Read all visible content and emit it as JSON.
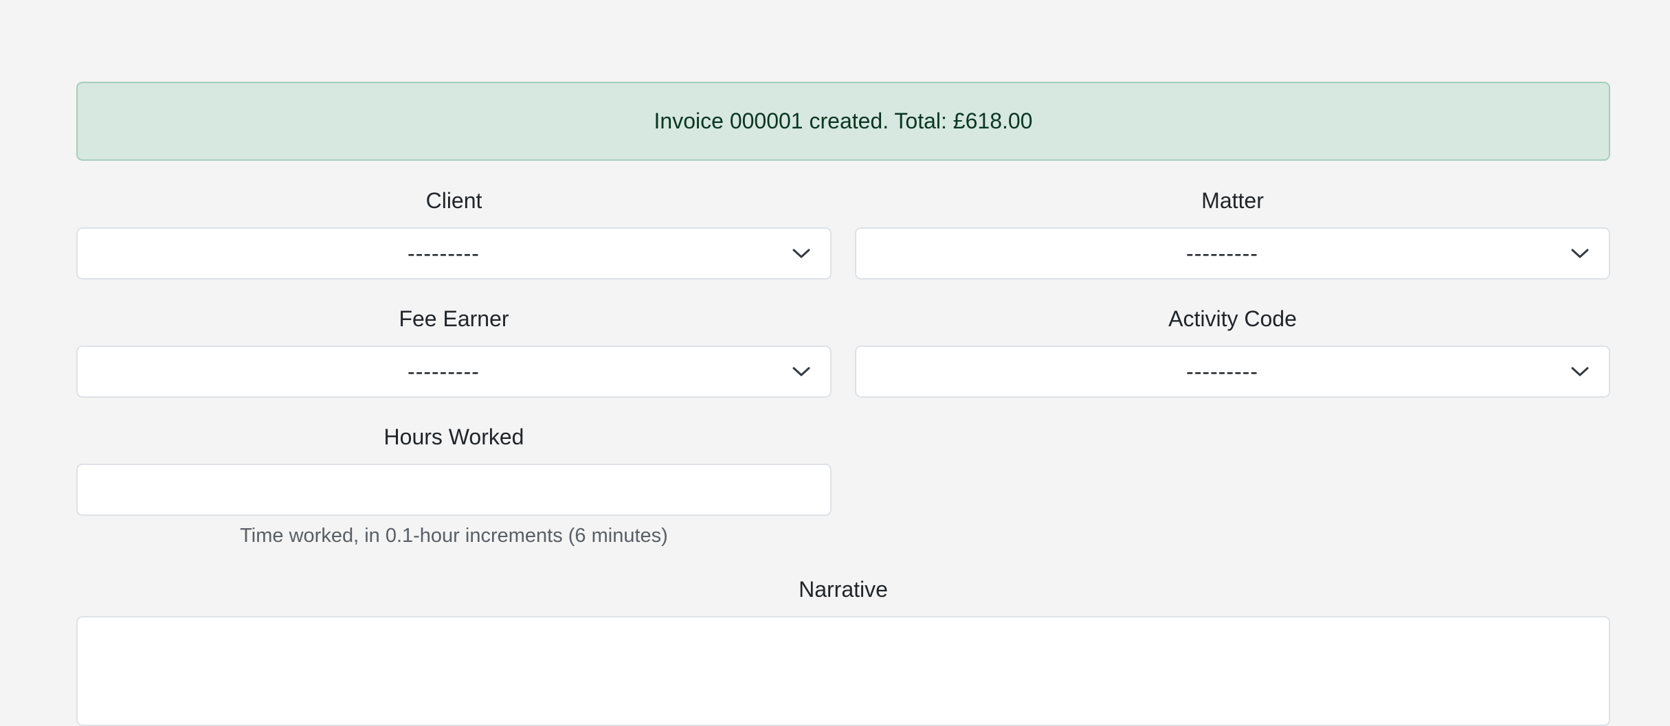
{
  "alert": {
    "message": "Invoice 000001 created. Total: £618.00",
    "color": "#d7e8e0"
  },
  "form": {
    "client": {
      "label": "Client",
      "selected": "---------"
    },
    "matter": {
      "label": "Matter",
      "selected": "---------"
    },
    "fee_earner": {
      "label": "Fee Earner",
      "selected": "---------"
    },
    "activity_code": {
      "label": "Activity Code",
      "selected": "---------"
    },
    "hours_worked": {
      "label": "Hours Worked",
      "value": "",
      "help": "Time worked, in 0.1-hour increments (6 minutes)"
    },
    "narrative": {
      "label": "Narrative",
      "value": ""
    }
  },
  "icons": {
    "dropdown": "chevron-down-icon"
  }
}
